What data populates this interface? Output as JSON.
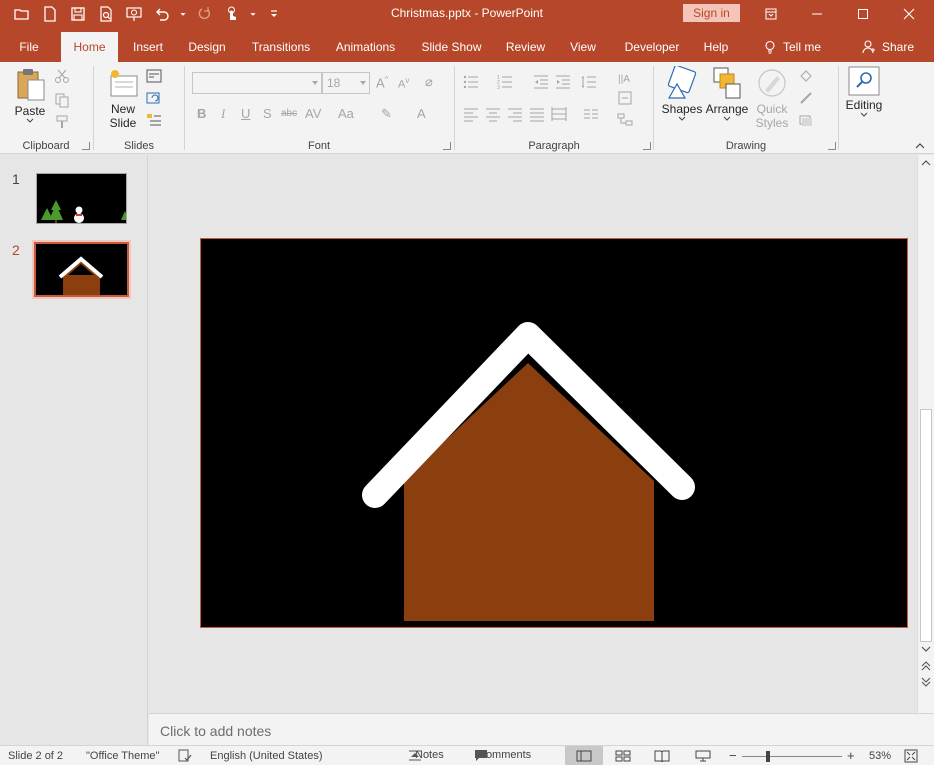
{
  "window": {
    "title": "Christmas.pptx  -  PowerPoint",
    "signin_label": "Sign in"
  },
  "tabs": [
    {
      "label": "File"
    },
    {
      "label": "Home"
    },
    {
      "label": "Insert"
    },
    {
      "label": "Design"
    },
    {
      "label": "Transitions"
    },
    {
      "label": "Animations"
    },
    {
      "label": "Slide Show"
    },
    {
      "label": "Review"
    },
    {
      "label": "View"
    },
    {
      "label": "Developer"
    },
    {
      "label": "Help"
    },
    {
      "label": "Tell me"
    },
    {
      "label": "Share"
    }
  ],
  "ribbon": {
    "clipboard": {
      "label": "Clipboard",
      "paste": "Paste"
    },
    "slides": {
      "label": "Slides",
      "new_slide_line1": "New",
      "new_slide_line2": "Slide"
    },
    "font": {
      "label": "Font",
      "font_name": "",
      "font_size": "18"
    },
    "paragraph": {
      "label": "Paragraph"
    },
    "drawing": {
      "label": "Drawing",
      "shapes": "Shapes",
      "arrange": "Arrange",
      "quick_styles_line1": "Quick",
      "quick_styles_line2": "Styles"
    },
    "editing": {
      "label": "Editing"
    }
  },
  "thumbnails": [
    {
      "number": "1"
    },
    {
      "number": "2"
    }
  ],
  "notes_placeholder": "Click to add notes",
  "status": {
    "slide_count": "Slide 2 of 2",
    "theme": "\"Office Theme\"",
    "language": "English (United States)",
    "notes": "Notes",
    "comments": "Comments",
    "zoom": "53%"
  },
  "colors": {
    "accent": "#b7472a",
    "house_body": "#8b3e0e",
    "roof": "#ffffff",
    "slide_bg": "#000000",
    "tree": "#4a9a2e"
  }
}
